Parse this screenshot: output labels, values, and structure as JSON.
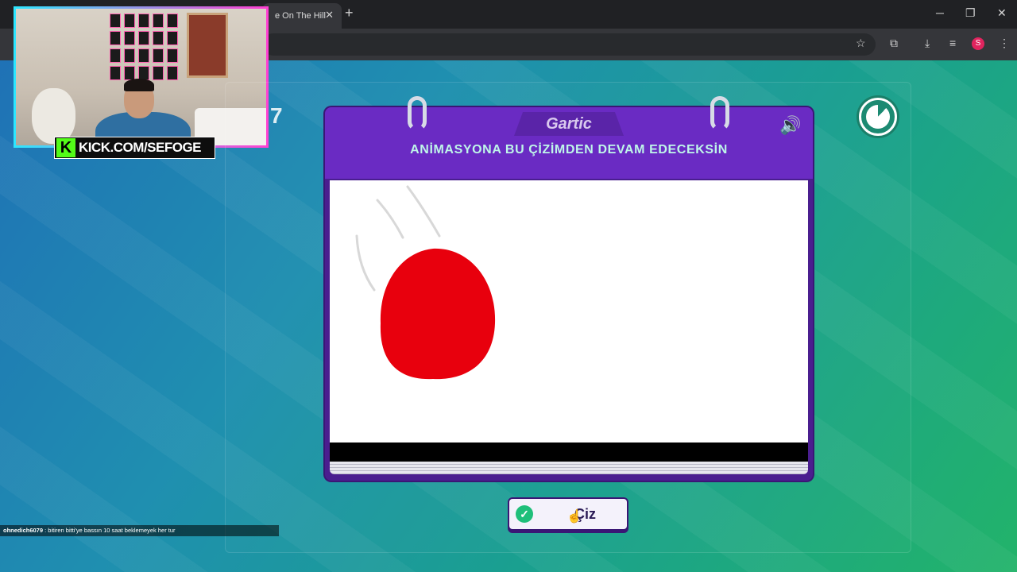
{
  "browser": {
    "tab_title": "e On The Hill",
    "tab_close": "✕",
    "new_tab": "+",
    "minimize": "─",
    "restore": "❐",
    "close": "✕",
    "profile_initial": "S"
  },
  "overlay": {
    "kick_url": "KICK.COM/SEFOGE",
    "kick_logo": "K",
    "stray_number": "7"
  },
  "game": {
    "logo": "Gartic",
    "instruction": "ANİMASYONA BU ÇİZİMDEN DEVAM EDECEKSİN",
    "draw_button": "Çiz",
    "timer_fraction_remaining": 0.88
  },
  "chat": {
    "user": "ohnedich6079",
    "message": ": bitiren bitti'ye bassın 10 saat beklemeyek her tur"
  },
  "colors": {
    "sheet": "#4a1e8f",
    "header": "#6a2bc3",
    "instruction_text": "#bff6e9",
    "drawing_red": "#e8000d",
    "kick_green": "#53fc18"
  }
}
